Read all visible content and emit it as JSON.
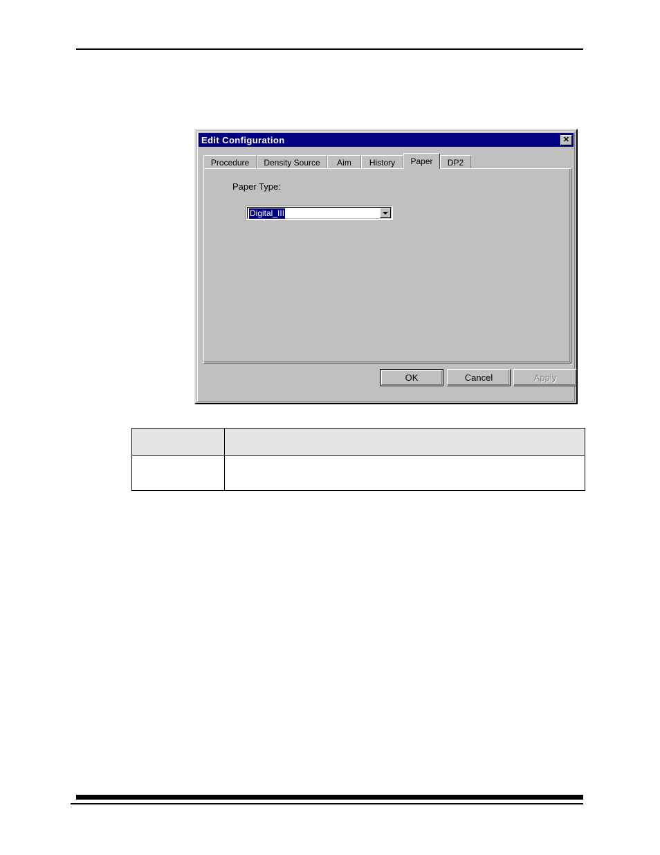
{
  "page": {
    "header_rule": "horizontal-rule",
    "footer_rule": "horizontal-rule"
  },
  "dialog": {
    "title": "Edit Configuration",
    "close_label": "✕",
    "tabs": [
      {
        "label": "Procedure",
        "active": false
      },
      {
        "label": "Density Source",
        "active": false
      },
      {
        "label": "Aim",
        "active": false
      },
      {
        "label": "History",
        "active": false
      },
      {
        "label": "Paper",
        "active": true
      },
      {
        "label": "DP2",
        "active": false
      }
    ],
    "paper_tab": {
      "paper_type_label": "Paper Type:",
      "paper_type_value": "Digital_III",
      "dropdown_icon": "chevron-down-icon"
    },
    "buttons": {
      "ok": "OK",
      "cancel": "Cancel",
      "apply": "Apply"
    },
    "colors": {
      "titlebar": "#000080",
      "face": "#c0c0c0",
      "selection": "#000080",
      "disabled_text": "#808080"
    }
  },
  "table": {
    "headers": [
      "",
      ""
    ],
    "rows": [
      [
        "",
        ""
      ]
    ]
  }
}
